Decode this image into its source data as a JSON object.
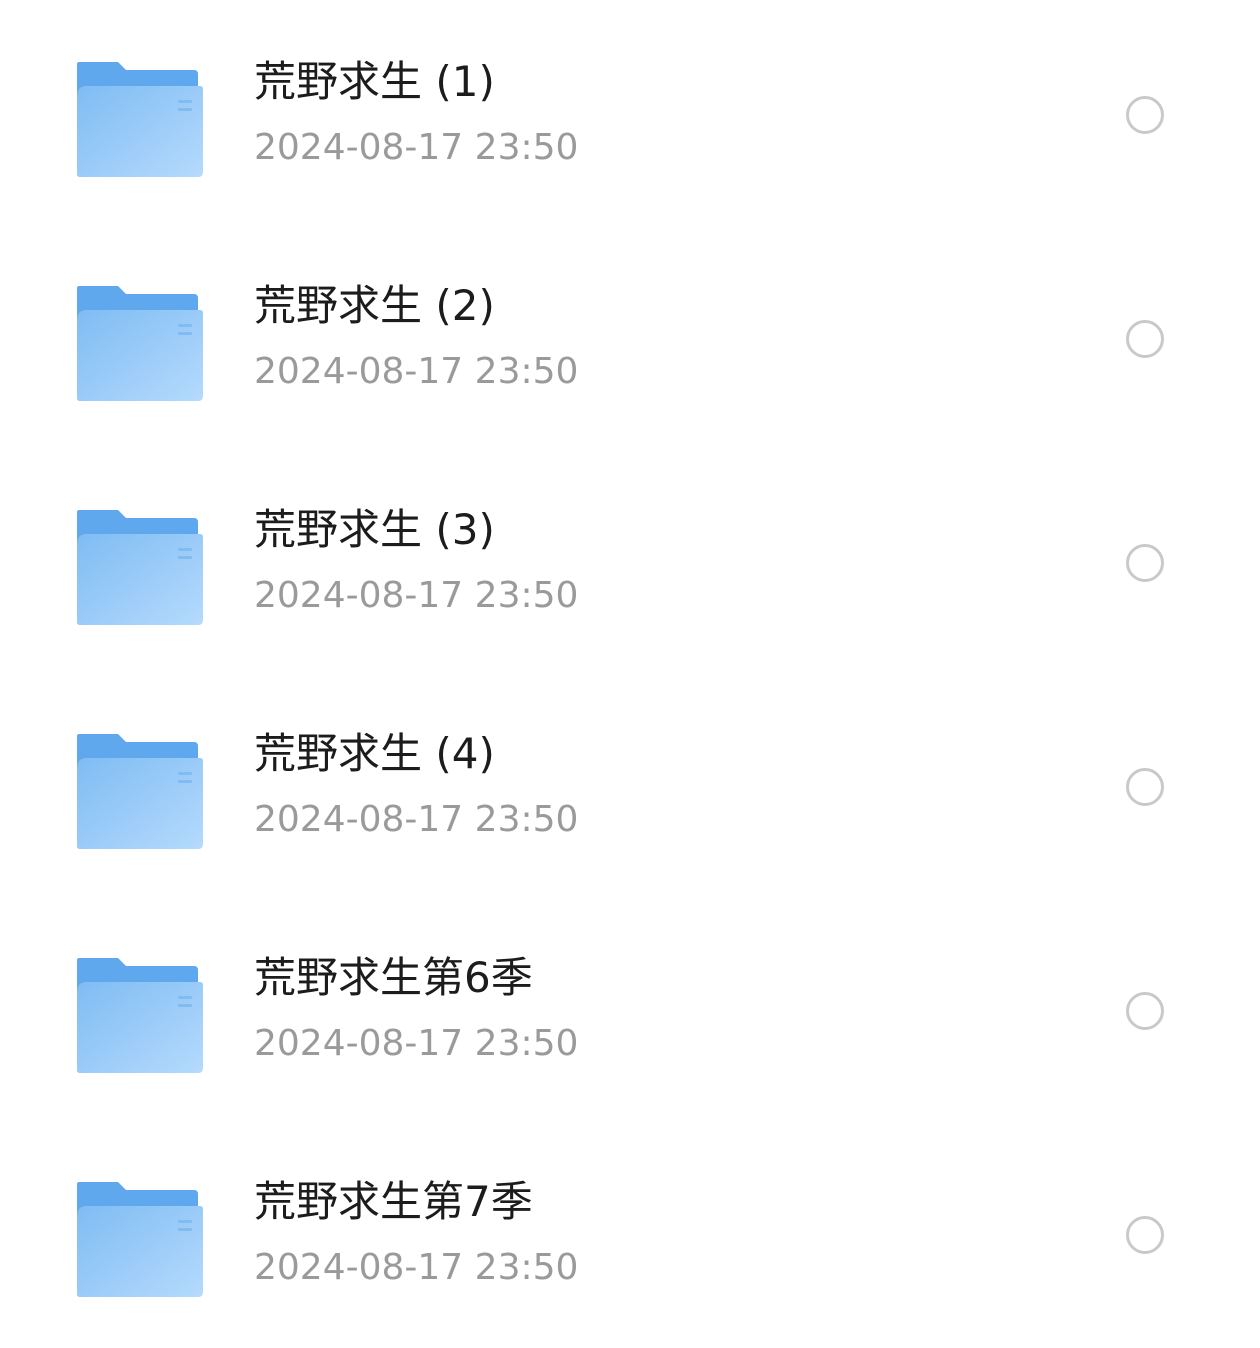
{
  "colors": {
    "folder_back": "#5fa8ee",
    "folder_front_light": "#b5dafd",
    "folder_front_dark": "#7fbcf3",
    "name_text": "#1c1c1c",
    "date_text": "#9a9a9a",
    "radio_border": "#c9c9c9"
  },
  "icons": {
    "folder": "folder-icon",
    "select": "radio-unchecked-icon"
  },
  "files": [
    {
      "name": "荒野求生 (1)",
      "date": "2024-08-17 23:50"
    },
    {
      "name": "荒野求生 (2)",
      "date": "2024-08-17 23:50"
    },
    {
      "name": "荒野求生 (3)",
      "date": "2024-08-17 23:50"
    },
    {
      "name": "荒野求生 (4)",
      "date": "2024-08-17 23:50"
    },
    {
      "name": "荒野求生第6季",
      "date": "2024-08-17 23:50"
    },
    {
      "name": "荒野求生第7季",
      "date": "2024-08-17 23:50"
    }
  ]
}
